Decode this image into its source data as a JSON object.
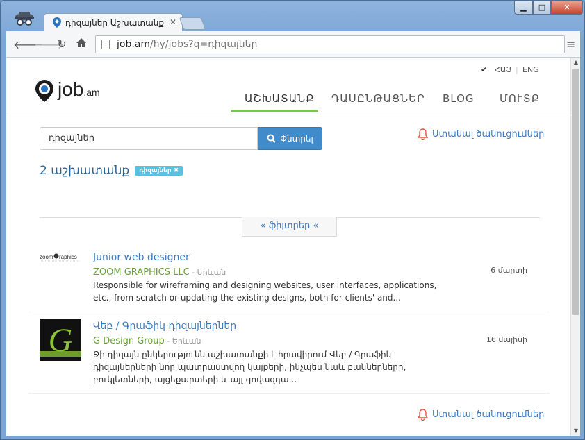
{
  "browser": {
    "tab_title": "դիզայներ Աշխատանք",
    "url_host": "job.am",
    "url_path": "/hy/jobs?q=դիզայներ",
    "window_controls": {
      "minimize": "▁",
      "maximize": "□",
      "close": "✕"
    }
  },
  "site": {
    "logo_text": "job",
    "logo_suffix": ".am",
    "lang_active": "ՀԱՅ",
    "lang_other": "ENG",
    "nav": [
      {
        "label": "ԱՇԽԱՏԱՆՔ",
        "active": true
      },
      {
        "label": "ԴԱՍԸՆԹԱՑՆԵՐ",
        "active": false
      },
      {
        "label": "BLOG",
        "active": false
      },
      {
        "label": "ՄՈՒՏՔ",
        "active": false
      }
    ]
  },
  "search": {
    "query": "դիզայներ",
    "button_label": "Փնտրել",
    "alert_label": "Ստանալ ծանուցումներ"
  },
  "results": {
    "count_label": "2 աշխատանք",
    "tag": "դիզայներ",
    "filters_label": "ֆիլտրեր"
  },
  "jobs": [
    {
      "title": "Junior web designer",
      "company": "ZOOM GRAPHICS LLC",
      "city": "Երևան",
      "description": "Responsible for wireframing and designing websites, user interfaces, applications, etc., from scratch or updating the existing designs, both for clients' and...",
      "date": "6 մարտի",
      "logo": "zoom graphics"
    },
    {
      "title": "Վեբ / Գրաֆիկ դիզայներներ",
      "company": "G Design Group",
      "city": "Երևան",
      "description": "Ջի դիզայն ընկերությունն աշխատանքի է հրավիրում Վեբ / Գրաֆիկ դիզայներների նոր պատրաստվող կայքերի, ինչպես նաև բաններների, բուկլետների, այցեքարտերի և այլ գովազդա...",
      "date": "16 մայիսի",
      "logo": "G"
    }
  ],
  "footer_alert_label": "Ստանալ ծանուցումներ",
  "colors": {
    "accent": "#428bca",
    "nav_active": "#7cc25a",
    "company": "#6aa13a",
    "bell": "#e8533c",
    "badge": "#5bc0de"
  }
}
